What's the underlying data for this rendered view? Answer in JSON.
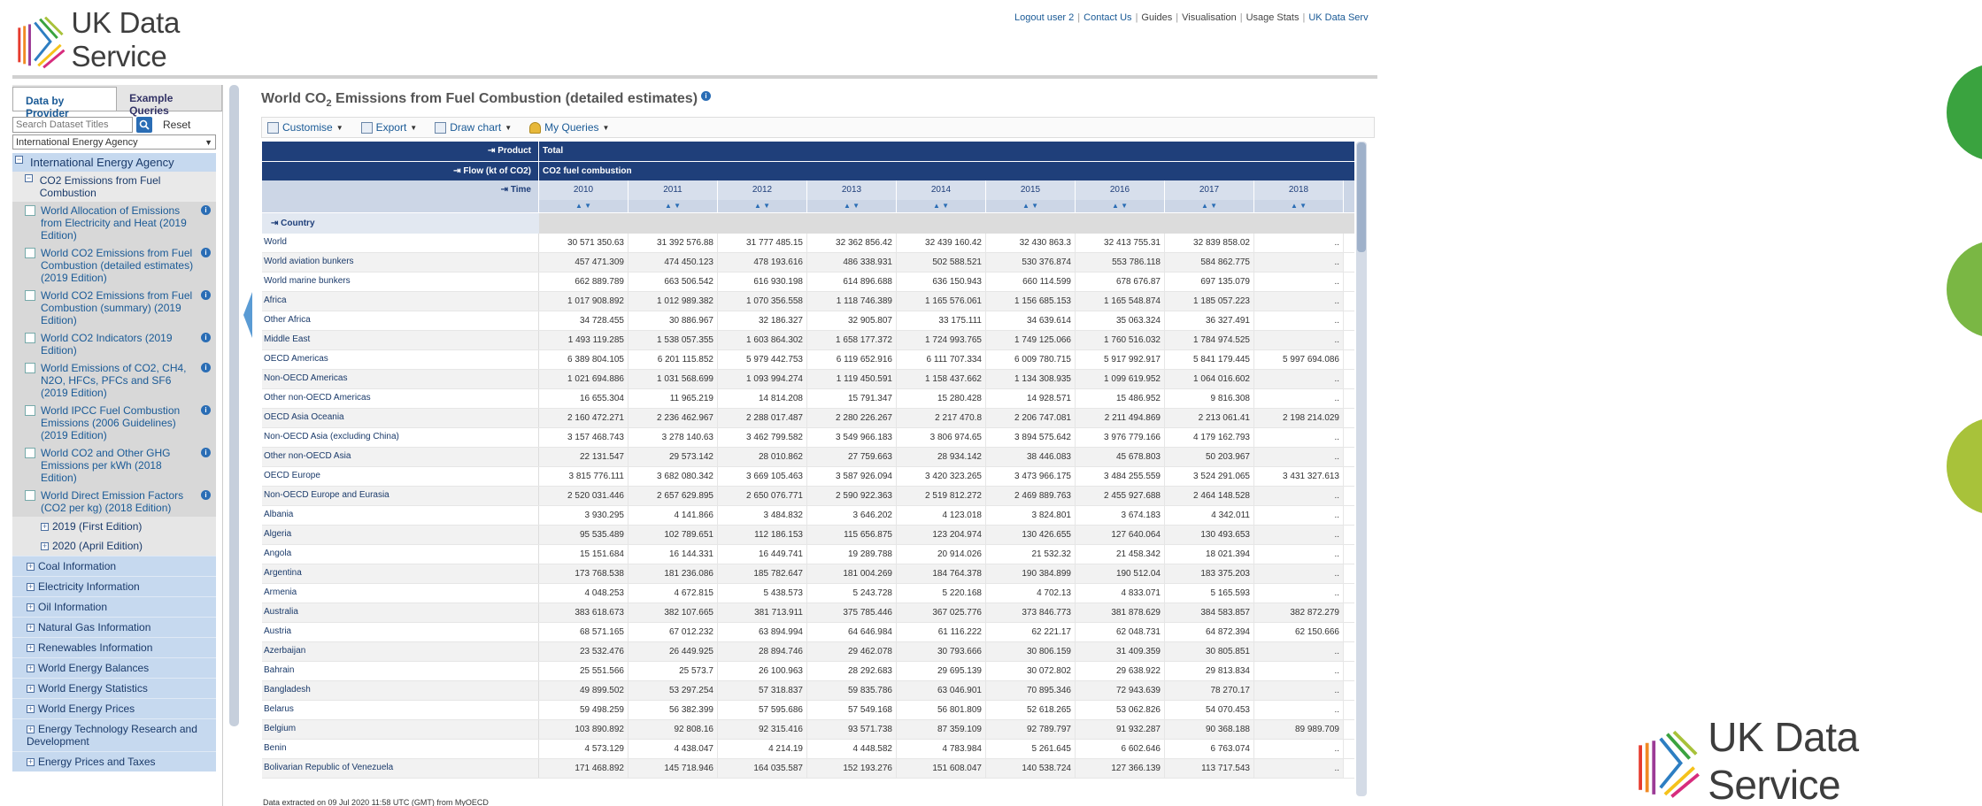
{
  "brand": {
    "name": "UK Data Service"
  },
  "toplinks": [
    "Logout user 2",
    "Contact Us",
    "Guides",
    "Visualisation",
    "Usage Stats",
    "UK Data Serv"
  ],
  "sidebar": {
    "tabs": [
      "Data by Provider",
      "Example Queries"
    ],
    "search_placeholder": "Search Dataset Titles",
    "reset_label": "Reset",
    "provider_select": "International Energy Agency",
    "root": "International Energy Agency",
    "group": "CO2 Emissions from Fuel Combustion",
    "leaves": [
      "World Allocation of Emissions from Electricity and Heat (2019 Edition)",
      "World CO2 Emissions from Fuel Combustion (detailed estimates) (2019 Edition)",
      "World CO2 Emissions from Fuel Combustion (summary) (2019 Edition)",
      "World CO2 Indicators (2019 Edition)",
      "World Emissions of CO2, CH4, N2O, HFCs, PFCs and SF6 (2019 Edition)",
      "World IPCC Fuel Combustion Emissions (2006 Guidelines) (2019 Edition)",
      "World CO2 and Other GHG Emissions per kWh (2018 Edition)",
      "World Direct Emission Factors (CO2 per kg) (2018 Edition)"
    ],
    "subgroups": [
      "2019 (First Edition)",
      "2020 (April Edition)"
    ],
    "categories": [
      "Coal Information",
      "Electricity Information",
      "Oil Information",
      "Natural Gas Information",
      "Renewables Information",
      "World Energy Balances",
      "World Energy Statistics",
      "World Energy Prices",
      "Energy Technology Research and Development",
      "Energy Prices and Taxes"
    ]
  },
  "main": {
    "title_pre": "World CO",
    "title_sub": "2",
    "title_post": " Emissions from Fuel Combustion (detailed estimates)",
    "toolbar": [
      "Customise",
      "Export",
      "Draw chart",
      "My Queries"
    ],
    "product_label": "Product",
    "product_value": "Total",
    "flow_label": "Flow (kt of CO2)",
    "flow_value": "CO2 fuel combustion",
    "time_label": "Time",
    "country_label": "Country",
    "years": [
      "2010",
      "2011",
      "2012",
      "2013",
      "2014",
      "2015",
      "2016",
      "2017",
      "2018"
    ],
    "rows": [
      {
        "name": "World",
        "v": [
          "30 571 350.63",
          "31 392 576.88",
          "31 777 485.15",
          "32 362 856.42",
          "32 439 160.42",
          "32 430 863.3",
          "32 413 755.31",
          "32 839 858.02",
          ".."
        ]
      },
      {
        "name": "World aviation bunkers",
        "v": [
          "457 471.309",
          "474 450.123",
          "478 193.616",
          "486 338.931",
          "502 588.521",
          "530 376.874",
          "553 786.118",
          "584 862.775",
          ".."
        ]
      },
      {
        "name": "World marine bunkers",
        "v": [
          "662 889.789",
          "663 506.542",
          "616 930.198",
          "614 896.688",
          "636 150.943",
          "660 114.599",
          "678 676.87",
          "697 135.079",
          ".."
        ]
      },
      {
        "name": "Africa",
        "v": [
          "1 017 908.892",
          "1 012 989.382",
          "1 070 356.558",
          "1 118 746.389",
          "1 165 576.061",
          "1 156 685.153",
          "1 165 548.874",
          "1 185 057.223",
          ".."
        ]
      },
      {
        "name": "Other Africa",
        "v": [
          "34 728.455",
          "30 886.967",
          "32 186.327",
          "32 905.807",
          "33 175.111",
          "34 639.614",
          "35 063.324",
          "36 327.491",
          ".."
        ]
      },
      {
        "name": "Middle East",
        "v": [
          "1 493 119.285",
          "1 538 057.355",
          "1 603 864.302",
          "1 658 177.372",
          "1 724 993.765",
          "1 749 125.066",
          "1 760 516.032",
          "1 784 974.525",
          ".."
        ]
      },
      {
        "name": "OECD Americas",
        "v": [
          "6 389 804.105",
          "6 201 115.852",
          "5 979 442.753",
          "6 119 652.916",
          "6 111 707.334",
          "6 009 780.715",
          "5 917 992.917",
          "5 841 179.445",
          "5 997 694.086"
        ]
      },
      {
        "name": "Non-OECD Americas",
        "v": [
          "1 021 694.886",
          "1 031 568.699",
          "1 093 994.274",
          "1 119 450.591",
          "1 158 437.662",
          "1 134 308.935",
          "1 099 619.952",
          "1 064 016.602",
          ".."
        ]
      },
      {
        "name": "Other non-OECD Americas",
        "v": [
          "16 655.304",
          "11 965.219",
          "14 814.208",
          "15 791.347",
          "15 280.428",
          "14 928.571",
          "15 486.952",
          "9 816.308",
          ".."
        ]
      },
      {
        "name": "OECD Asia Oceania",
        "v": [
          "2 160 472.271",
          "2 236 462.967",
          "2 288 017.487",
          "2 280 226.267",
          "2 217 470.8",
          "2 206 747.081",
          "2 211 494.869",
          "2 213 061.41",
          "2 198 214.029"
        ]
      },
      {
        "name": "Non-OECD Asia (excluding China)",
        "v": [
          "3 157 468.743",
          "3 278 140.63",
          "3 462 799.582",
          "3 549 966.183",
          "3 806 974.65",
          "3 894 575.642",
          "3 976 779.166",
          "4 179 162.793",
          ".."
        ]
      },
      {
        "name": "Other non-OECD Asia",
        "v": [
          "22 131.547",
          "29 573.142",
          "28 010.862",
          "27 759.663",
          "28 934.142",
          "38 446.083",
          "45 678.803",
          "50 203.967",
          ".."
        ]
      },
      {
        "name": "OECD Europe",
        "v": [
          "3 815 776.111",
          "3 682 080.342",
          "3 669 105.463",
          "3 587 926.094",
          "3 420 323.265",
          "3 473 966.175",
          "3 484 255.559",
          "3 524 291.065",
          "3 431 327.613"
        ]
      },
      {
        "name": "Non-OECD Europe and Eurasia",
        "v": [
          "2 520 031.446",
          "2 657 629.895",
          "2 650 076.771",
          "2 590 922.363",
          "2 519 812.272",
          "2 469 889.763",
          "2 455 927.688",
          "2 464 148.528",
          ".."
        ]
      },
      {
        "name": "Albania",
        "v": [
          "3 930.295",
          "4 141.866",
          "3 484.832",
          "3 646.202",
          "4 123.018",
          "3 824.801",
          "3 674.183",
          "4 342.011",
          ".."
        ]
      },
      {
        "name": "Algeria",
        "v": [
          "95 535.489",
          "102 789.651",
          "112 186.153",
          "115 656.875",
          "123 204.974",
          "130 426.655",
          "127 640.064",
          "130 493.653",
          ".."
        ]
      },
      {
        "name": "Angola",
        "v": [
          "15 151.684",
          "16 144.331",
          "16 449.741",
          "19 289.788",
          "20 914.026",
          "21 532.32",
          "21 458.342",
          "18 021.394",
          ".."
        ]
      },
      {
        "name": "Argentina",
        "v": [
          "173 768.538",
          "181 236.086",
          "185 782.647",
          "181 004.269",
          "184 764.378",
          "190 384.899",
          "190 512.04",
          "183 375.203",
          ".."
        ]
      },
      {
        "name": "Armenia",
        "v": [
          "4 048.253",
          "4 672.815",
          "5 438.573",
          "5 243.728",
          "5 220.168",
          "4 702.13",
          "4 833.071",
          "5 165.593",
          ".."
        ]
      },
      {
        "name": "Australia",
        "v": [
          "383 618.673",
          "382 107.665",
          "381 713.911",
          "375 785.446",
          "367 025.776",
          "373 846.773",
          "381 878.629",
          "384 583.857",
          "382 872.279"
        ]
      },
      {
        "name": "Austria",
        "v": [
          "68 571.165",
          "67 012.232",
          "63 894.994",
          "64 646.984",
          "61 116.222",
          "62 221.17",
          "62 048.731",
          "64 872.394",
          "62 150.666"
        ]
      },
      {
        "name": "Azerbaijan",
        "v": [
          "23 532.476",
          "26 449.925",
          "28 894.746",
          "29 462.078",
          "30 793.666",
          "30 806.159",
          "31 409.359",
          "30 805.851",
          ".."
        ]
      },
      {
        "name": "Bahrain",
        "v": [
          "25 551.566",
          "25 573.7",
          "26 100.963",
          "28 292.683",
          "29 695.139",
          "30 072.802",
          "29 638.922",
          "29 813.834",
          ".."
        ]
      },
      {
        "name": "Bangladesh",
        "v": [
          "49 899.502",
          "53 297.254",
          "57 318.837",
          "59 835.786",
          "63 046.901",
          "70 895.346",
          "72 943.639",
          "78 270.17",
          ".."
        ]
      },
      {
        "name": "Belarus",
        "v": [
          "59 498.259",
          "56 382.399",
          "57 595.686",
          "57 549.168",
          "56 801.809",
          "52 618.265",
          "53 062.826",
          "54 070.453",
          ".."
        ]
      },
      {
        "name": "Belgium",
        "v": [
          "103 890.892",
          "92 808.16",
          "92 315.416",
          "93 571.738",
          "87 359.109",
          "92 789.797",
          "91 932.287",
          "90 368.188",
          "89 989.709"
        ]
      },
      {
        "name": "Benin",
        "v": [
          "4 573.129",
          "4 438.047",
          "4 214.19",
          "4 448.582",
          "4 783.984",
          "5 261.645",
          "6 602.646",
          "6 763.074",
          ".."
        ]
      },
      {
        "name": "Bolivarian Republic of Venezuela",
        "v": [
          "171 468.892",
          "145 718.946",
          "164 035.587",
          "152 193.276",
          "151 608.047",
          "140 538.724",
          "127 366.139",
          "113 717.543",
          ".."
        ]
      }
    ],
    "extract_note": "Data extracted on 09 Jul 2020 11:58 UTC (GMT) from MyOECD"
  },
  "colors": {
    "header_blue": "#1f3f7a",
    "link_blue": "#1a5a96",
    "circle_green_1": "#3aa33f",
    "circle_green_2": "#7ab744",
    "circle_green_3": "#a8c23a"
  }
}
